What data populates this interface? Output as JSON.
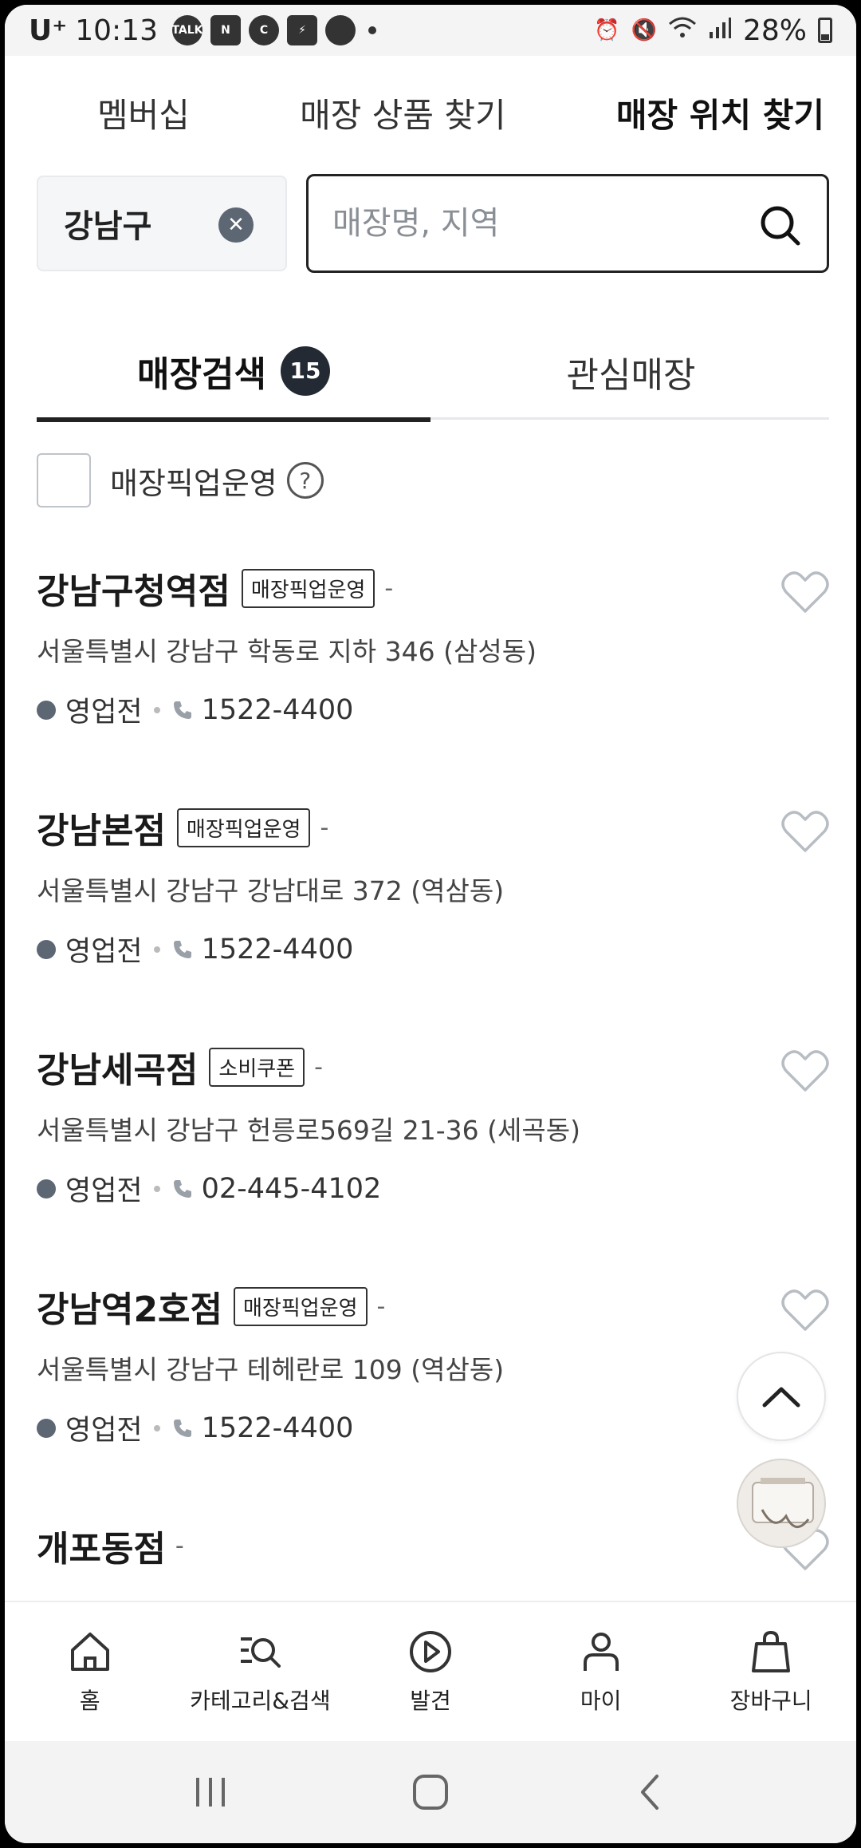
{
  "status_bar": {
    "carrier": "U⁺",
    "time": "10:13",
    "notif_icons": [
      "talk-icon",
      "n-icon",
      "c-icon",
      "app-icon",
      "chat-bubble-icon"
    ],
    "battery": "28%"
  },
  "top_tabs": {
    "membership": "멤버십",
    "find_product": "매장 상품 찾기",
    "find_location": "매장 위치 찾기"
  },
  "search": {
    "region": "강남구",
    "placeholder": "매장명, 지역"
  },
  "store_tabs": {
    "search_label": "매장검색",
    "count": "15",
    "favorites_label": "관심매장"
  },
  "filter": {
    "pickup_label": "매장픽업운영",
    "help": "?"
  },
  "stores": [
    {
      "name": "강남구청역점",
      "tag": "매장픽업운영",
      "dash": "-",
      "address": "서울특별시 강남구 학동로 지하 346 (삼성동)",
      "status": "영업전",
      "phone": "1522-4400"
    },
    {
      "name": "강남본점",
      "tag": "매장픽업운영",
      "dash": "-",
      "address": "서울특별시 강남구 강남대로 372 (역삼동)",
      "status": "영업전",
      "phone": "1522-4400"
    },
    {
      "name": "강남세곡점",
      "tag": "소비쿠폰",
      "dash": "-",
      "address": "서울특별시 강남구 헌릉로569길 21-36 (세곡동)",
      "status": "영업전",
      "phone": "02-445-4102"
    },
    {
      "name": "강남역2호점",
      "tag": "매장픽업운영",
      "dash": "-",
      "address": "서울특별시 강남구 테헤란로 109 (역삼동)",
      "status": "영업전",
      "phone": "1522-4400"
    },
    {
      "name": "개포동점",
      "dash": "-"
    }
  ],
  "bottom_nav": {
    "home": "홈",
    "category_search": "카테고리&검색",
    "discover": "발견",
    "my": "마이",
    "cart": "장바구니"
  },
  "colors": {
    "accent_dark": "#232a33",
    "status_dot": "#5d6673"
  }
}
